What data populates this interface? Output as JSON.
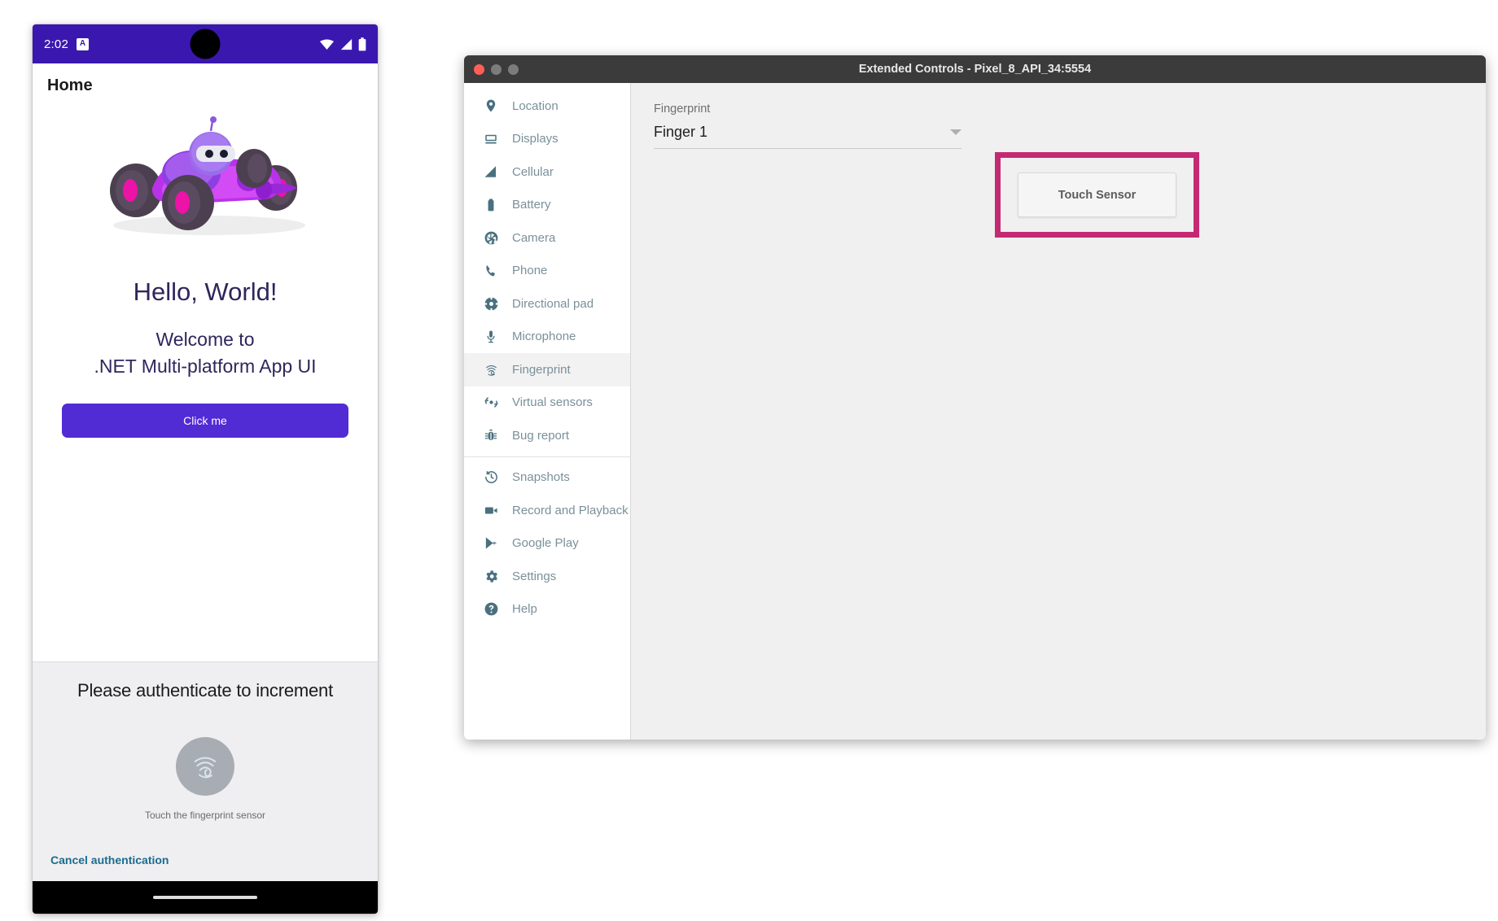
{
  "phone": {
    "status_bar": {
      "time": "2:02",
      "badge_icon": "app-notification-icon",
      "wifi_icon": "wifi-icon",
      "signal_icon": "cellular-signal-icon",
      "battery_icon": "battery-icon",
      "background_color": "#3A18B0"
    },
    "app_bar": {
      "title": "Home"
    },
    "content": {
      "hero_image_alt": "dotnet-bot-racecar",
      "heading": "Hello, World!",
      "welcome_line1": "Welcome to",
      "welcome_line2": ".NET Multi-platform App UI",
      "button_label": "Click me",
      "button_color": "#512BD4",
      "text_color": "#30255C"
    },
    "biometric_prompt": {
      "title": "Please authenticate to increment",
      "fingerprint_icon": "fingerprint-icon",
      "hint": "Touch the fingerprint sensor",
      "cancel_label": "Cancel authentication",
      "cancel_color": "#1B6B8F",
      "sheet_color": "#EFEFF1"
    },
    "navigation_bar": {
      "gesture_pill": "home-gesture-pill"
    }
  },
  "extended_controls": {
    "window": {
      "title": "Extended Controls - Pixel_8_API_34:5554",
      "titlebar_color": "#3B3B3B",
      "close_button": "close-window-button",
      "minimize_button": "minimize-window-button",
      "zoom_button": "zoom-window-button"
    },
    "sidebar": {
      "groups": [
        {
          "items": [
            {
              "label": "Location",
              "icon": "location-pin-icon",
              "selected": false
            },
            {
              "label": "Displays",
              "icon": "display-icon",
              "selected": false
            },
            {
              "label": "Cellular",
              "icon": "cellular-signal-icon",
              "selected": false
            },
            {
              "label": "Battery",
              "icon": "battery-icon",
              "selected": false
            },
            {
              "label": "Camera",
              "icon": "camera-aperture-icon",
              "selected": false
            },
            {
              "label": "Phone",
              "icon": "phone-handset-icon",
              "selected": false
            },
            {
              "label": "Directional pad",
              "icon": "dpad-icon",
              "selected": false
            },
            {
              "label": "Microphone",
              "icon": "microphone-icon",
              "selected": false
            },
            {
              "label": "Fingerprint",
              "icon": "fingerprint-icon",
              "selected": true
            },
            {
              "label": "Virtual sensors",
              "icon": "virtual-sensors-icon",
              "selected": false
            },
            {
              "label": "Bug report",
              "icon": "bug-icon",
              "selected": false
            }
          ]
        },
        {
          "items": [
            {
              "label": "Snapshots",
              "icon": "history-clock-icon",
              "selected": false
            },
            {
              "label": "Record and Playback",
              "icon": "video-camera-icon",
              "selected": false
            },
            {
              "label": "Google Play",
              "icon": "google-play-icon",
              "selected": false
            },
            {
              "label": "Settings",
              "icon": "gear-icon",
              "selected": false
            },
            {
              "label": "Help",
              "icon": "question-mark-circle-icon",
              "selected": false
            }
          ]
        }
      ],
      "icon_color": "#4A707F",
      "label_color": "#7A909A"
    },
    "panel": {
      "fingerprint_label": "Fingerprint",
      "finger_selected": "Finger 1",
      "finger_options": [
        "Finger 1"
      ],
      "dropdown_caret": "chevron-down-icon",
      "touch_sensor_label": "Touch Sensor",
      "highlight_color": "#C42A73",
      "background_color": "#F0F0F0"
    }
  }
}
